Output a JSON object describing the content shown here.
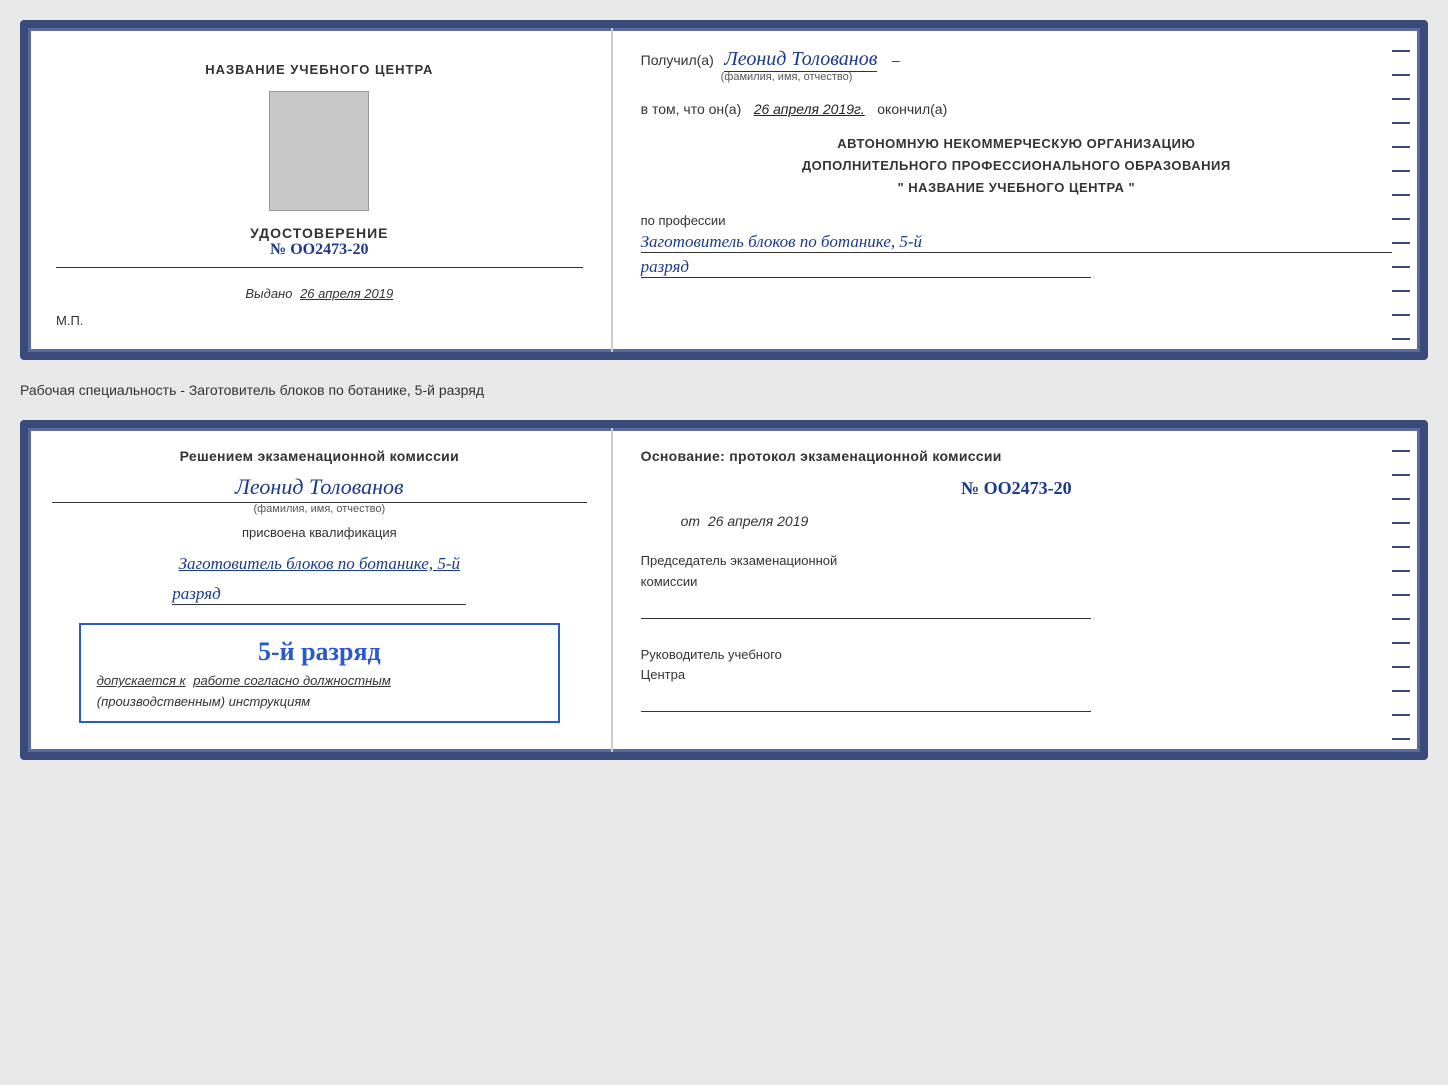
{
  "card1": {
    "left": {
      "training_center": "НАЗВАНИЕ УЧЕБНОГО ЦЕНТРА",
      "cert_title": "УДОСТОВЕРЕНИЕ",
      "cert_number": "№ OO2473-20",
      "issued_label": "Выдано",
      "issued_date": "26 апреля 2019",
      "mp_label": "М.П."
    },
    "right": {
      "received_prefix": "Получил(а)",
      "recipient_name": "Леонид Толованов",
      "name_sublabel": "(фамилия, имя, отчество)",
      "confirm_prefix": "в том, что он(а)",
      "confirm_date": "26 апреля 2019г.",
      "confirm_suffix": "окончил(а)",
      "org_line1": "АВТОНОМНУЮ НЕКОММЕРЧЕСКУЮ ОРГАНИЗАЦИЮ",
      "org_line2": "ДОПОЛНИТЕЛЬНОГО ПРОФЕССИОНАЛЬНОГО ОБРАЗОВАНИЯ",
      "org_line3": "\"  НАЗВАНИЕ УЧЕБНОГО ЦЕНТРА  \"",
      "profession_label": "по профессии",
      "profession_name": "Заготовитель блоков по ботанике, 5-й",
      "razryad": "разряд"
    }
  },
  "specialty_label": "Рабочая специальность - Заготовитель блоков по ботанике, 5-й разряд",
  "card2": {
    "left": {
      "decision_text": "Решением экзаменационной комиссии",
      "person_name": "Леонид Толованов",
      "name_sublabel": "(фамилия, имя, отчество)",
      "qualification_label": "присвоена квалификация",
      "qualification_name": "Заготовитель блоков по ботанике, 5-й",
      "razryad": "разряд",
      "stamp_title": "5-й разряд",
      "stamp_line1": "допускается к",
      "stamp_underline": "работе согласно должностным",
      "stamp_italic": "(производственным) инструкциям"
    },
    "right": {
      "basis_title": "Основание: протокол экзаменационной комиссии",
      "protocol_number": "№ OO2473-20",
      "date_prefix": "от",
      "date_value": "26 апреля 2019",
      "chairman_line1": "Председатель экзаменационной",
      "chairman_line2": "комиссии",
      "director_line1": "Руководитель учебного",
      "director_line2": "Центра"
    }
  }
}
